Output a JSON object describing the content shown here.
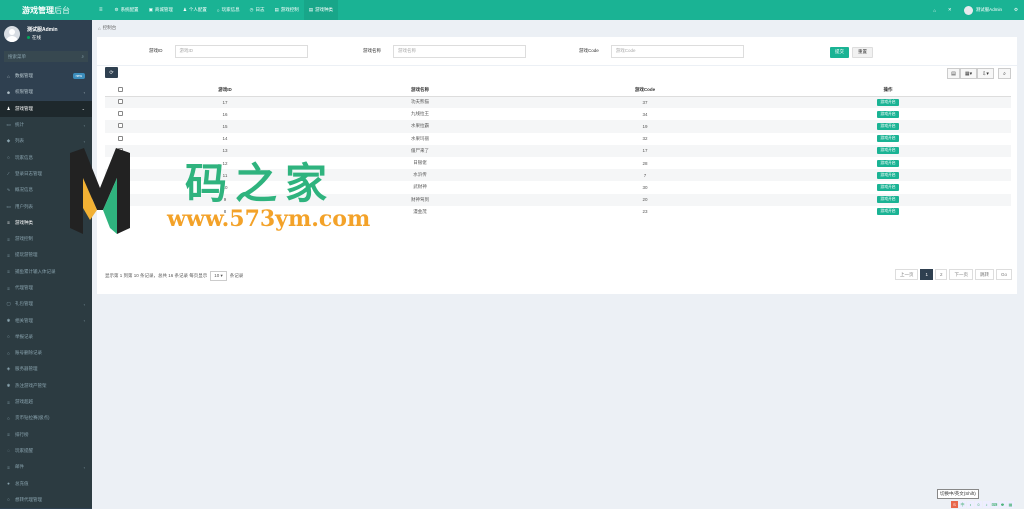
{
  "sidebar": {
    "logo_bold": "游戏管理",
    "logo_light": "后台",
    "user_name": "测试服Admin",
    "user_status": "在线",
    "search_placeholder": "搜索菜单",
    "items": [
      {
        "label": "数据管理",
        "icon": "desktop-icon",
        "glyph": "⌂",
        "badge": "new",
        "state": "normal"
      },
      {
        "label": "权限管理",
        "icon": "users-icon",
        "glyph": "☻",
        "arrow": "‹",
        "state": "normal"
      },
      {
        "label": "游戏管理",
        "icon": "gamepad-icon",
        "glyph": "♟",
        "arrow": "⌄",
        "state": "open"
      },
      {
        "label": "统计",
        "icon": "chart-icon",
        "glyph": "▭",
        "arrow": "‹",
        "state": "sub"
      },
      {
        "label": "列表",
        "icon": "pin-icon",
        "glyph": "◆",
        "arrow": "‹",
        "state": "sub"
      },
      {
        "label": "玩家信息",
        "icon": "circle-icon",
        "glyph": "○",
        "state": "sub"
      },
      {
        "label": "登录日志管理",
        "icon": "line-chart-icon",
        "glyph": "⁄",
        "state": "sub"
      },
      {
        "label": "概况信息",
        "icon": "pulse-icon",
        "glyph": "∿",
        "state": "sub"
      },
      {
        "label": "用户列表",
        "icon": "card-icon",
        "glyph": "▭",
        "state": "sub"
      },
      {
        "label": "游戏种类",
        "icon": "list-icon",
        "glyph": "≡",
        "state": "active"
      },
      {
        "label": "游戏控制",
        "icon": "list-icon",
        "glyph": "≡",
        "state": "sub"
      },
      {
        "label": "提玩游管理",
        "icon": "list-icon",
        "glyph": "≡",
        "state": "sub"
      },
      {
        "label": "捕鱼累计输入体记录",
        "icon": "list-icon",
        "glyph": "≡",
        "state": "sub"
      },
      {
        "label": "代理管理",
        "icon": "list-icon",
        "glyph": "≡",
        "state": "sub"
      },
      {
        "label": "礼包管理",
        "icon": "gift-icon",
        "glyph": "▢",
        "arrow": "‹",
        "state": "sub"
      },
      {
        "label": "相关管理",
        "icon": "cog-icon",
        "glyph": "✱",
        "arrow": "‹",
        "state": "sub"
      },
      {
        "label": "举报记录",
        "icon": "circle-icon",
        "glyph": "○",
        "state": "sub"
      },
      {
        "label": "账号删除记录",
        "icon": "circle-icon",
        "glyph": "○",
        "state": "sub"
      },
      {
        "label": "服务器管理",
        "icon": "diamond-icon",
        "glyph": "◈",
        "state": "sub"
      },
      {
        "label": "热注游戏产管架",
        "icon": "star-icon",
        "glyph": "✱",
        "state": "sub"
      },
      {
        "label": "游戏超越",
        "icon": "list-icon",
        "glyph": "≡",
        "state": "sub"
      },
      {
        "label": "货币钻拉赛(极点)",
        "icon": "circle-icon",
        "glyph": "○",
        "state": "sub"
      },
      {
        "label": "排行榜",
        "icon": "list-icon",
        "glyph": "≡",
        "state": "sub"
      },
      {
        "label": "玩家提醒",
        "icon": "chat-icon",
        "glyph": "◌",
        "state": "sub"
      },
      {
        "label": "邮件",
        "icon": "list-icon",
        "glyph": "≡",
        "arrow": "‹",
        "state": "sub"
      },
      {
        "label": "总充值",
        "icon": "circle-icon",
        "glyph": "●",
        "state": "sub"
      },
      {
        "label": "想转代理管理",
        "icon": "circle-icon",
        "glyph": "○",
        "state": "sub"
      }
    ]
  },
  "topbar": {
    "menu_glyph": "≡",
    "tabs": [
      {
        "label": "系统配置",
        "icon": "gear-icon",
        "glyph": "⚙"
      },
      {
        "label": "商城管理",
        "icon": "cart-icon",
        "glyph": "▣"
      },
      {
        "label": "个人配置",
        "icon": "user-icon",
        "glyph": "♟"
      },
      {
        "label": "玩家信息",
        "icon": "circle-icon",
        "glyph": "○"
      },
      {
        "label": "日志",
        "icon": "clock-icon",
        "glyph": "◷"
      },
      {
        "label": "游戏控制",
        "icon": "list-icon",
        "glyph": "▤"
      },
      {
        "label": "游戏种类",
        "icon": "list-icon",
        "glyph": "▤",
        "current": true
      }
    ],
    "home_glyph": "⌂",
    "fullscreen_glyph": "✕",
    "admin_name": "测试服Admin",
    "settings_glyph": "⚙"
  },
  "breadcrumb": "控制台",
  "filters": {
    "game_id_label": "游戏ID",
    "game_id_placeholder": "游戏ID",
    "game_name_label": "游戏名称",
    "game_name_placeholder": "游戏名称",
    "game_code_label": "游戏Code",
    "game_code_placeholder": "游戏Code",
    "submit": "提交",
    "reset": "重置"
  },
  "table": {
    "headers": [
      "游戏ID",
      "游戏名称",
      "游戏Code",
      "操作"
    ],
    "rows": [
      {
        "id": "17",
        "name": "功夫熊猫",
        "code": "37",
        "action": "游戏开启"
      },
      {
        "id": "16",
        "name": "九线拉王",
        "code": "34",
        "action": "游戏开启"
      },
      {
        "id": "15",
        "name": "水果拉霸",
        "code": "19",
        "action": "游戏开启"
      },
      {
        "id": "14",
        "name": "水果玛丽",
        "code": "32",
        "action": "游戏开启"
      },
      {
        "id": "13",
        "name": "僵尸来了",
        "code": "17",
        "action": "游戏开启"
      },
      {
        "id": "12",
        "name": "日银佬",
        "code": "28",
        "action": "游戏开启"
      },
      {
        "id": "11",
        "name": "水浒传",
        "code": "7",
        "action": "游戏开启"
      },
      {
        "id": "10",
        "name": "武财神",
        "code": "30",
        "action": "游戏开启"
      },
      {
        "id": "9",
        "name": "财神驾到",
        "code": "20",
        "action": "游戏开启"
      },
      {
        "id": "8",
        "name": "漫金茂",
        "code": "23",
        "action": "游戏开启"
      }
    ]
  },
  "pagination": {
    "info_prefix": "显示第 1 到第 10 条记录，总共 16 条记录 每页显示",
    "page_size": "10",
    "info_suffix": "条记录",
    "prev": "上一页",
    "pages": [
      "1",
      "2"
    ],
    "next": "下一页",
    "jump_placeholder": "跳转",
    "go": "Go"
  },
  "watermark": {
    "cn": "码之家",
    "url": "www.573ym.com"
  },
  "ime_tip": "切换中/英文(Shift)"
}
